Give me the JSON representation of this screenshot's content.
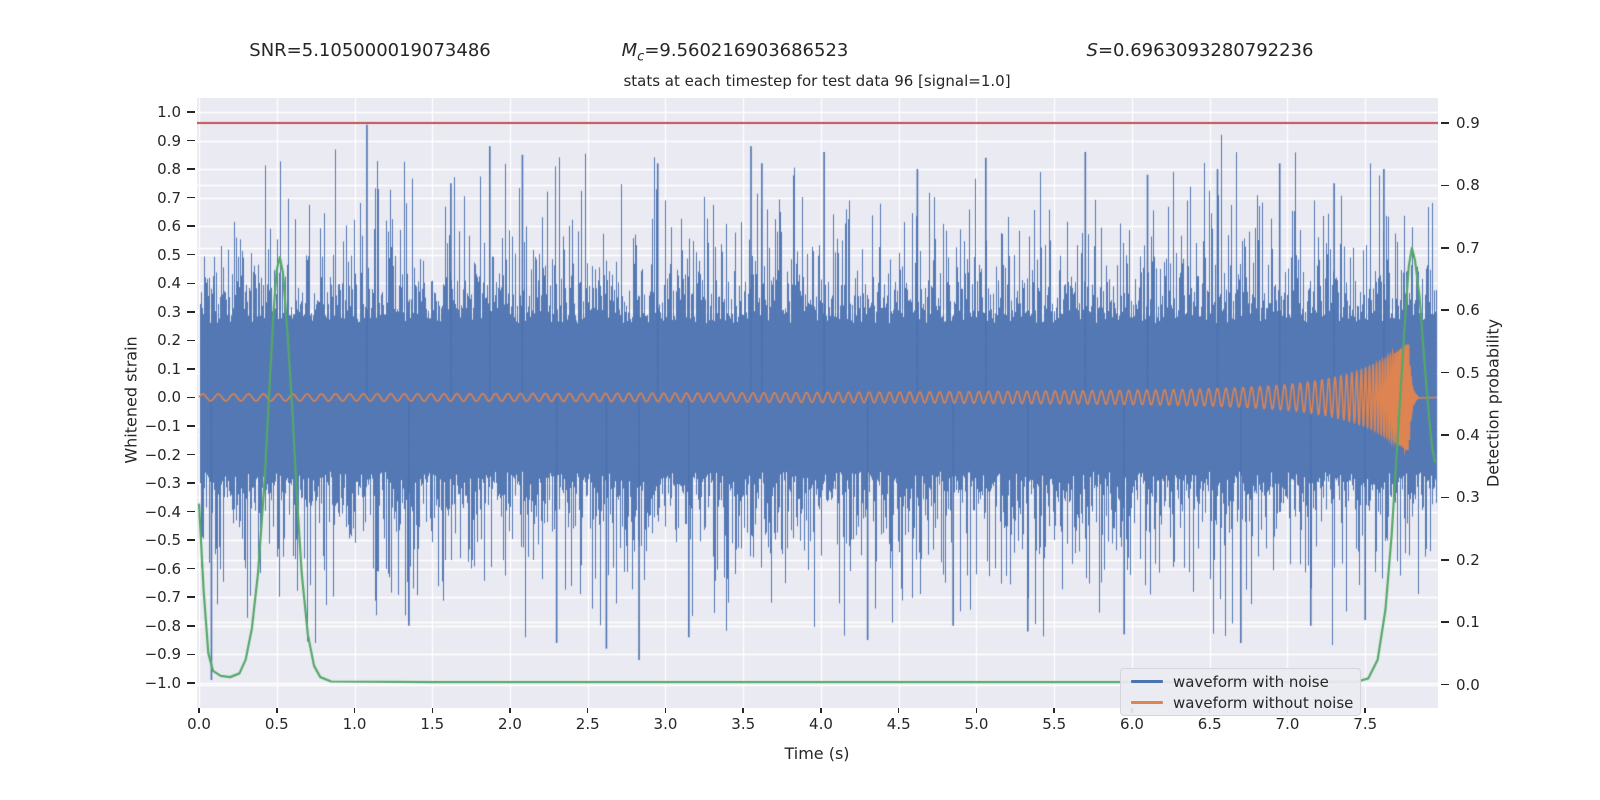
{
  "titles": {
    "snr": "SNR=5.105000019073486",
    "mc_var": "M",
    "mc_sub": "c",
    "mc_value": "=9.560216903686523",
    "s_var": "S",
    "s_value": "=0.6963093280792236",
    "subtitle": "stats at each timestep for test data 96 [signal=1.0]"
  },
  "legend": {
    "items": [
      {
        "label": "waveform with noise",
        "color": "#4C72B0"
      },
      {
        "label": "waveform without noise",
        "color": "#DD8452"
      }
    ]
  },
  "colors": {
    "noise_blue": "#4C72B0",
    "clean_orange": "#DD8452",
    "probability_green": "#55A868",
    "threshold_red": "#C44E52",
    "axes_bg": "#EAEAF2",
    "grid": "#ffffff",
    "text": "#262626"
  },
  "chart_data": {
    "type": "line",
    "title": "stats at each timestep for test data 96 [signal=1.0]",
    "xlabel": "Time (s)",
    "xlim": [
      -0.0129,
      7.968
    ],
    "xticks": [
      0.0,
      0.5,
      1.0,
      1.5,
      2.0,
      2.5,
      3.0,
      3.5,
      4.0,
      4.5,
      5.0,
      5.5,
      6.0,
      6.5,
      7.0,
      7.5
    ],
    "xtick_labels": [
      "0.0",
      "0.5",
      "1.0",
      "1.5",
      "2.0",
      "2.5",
      "3.0",
      "3.5",
      "4.0",
      "4.5",
      "5.0",
      "5.5",
      "6.0",
      "6.5",
      "7.0",
      "7.5"
    ],
    "grid": true,
    "legend_position": "lower right",
    "y_left": {
      "label": "Whitened strain",
      "lim": [
        -1.088,
        1.049
      ],
      "ticks": [
        1.0,
        0.9,
        0.8,
        0.7,
        0.6,
        0.5,
        0.4,
        0.3,
        0.2,
        0.1,
        0.0,
        -0.1,
        -0.2,
        -0.3,
        -0.4,
        -0.5,
        -0.6,
        -0.7,
        -0.8,
        -0.9,
        -1.0
      ],
      "tick_labels": [
        "1.0",
        "0.9",
        "0.8",
        "0.7",
        "0.6",
        "0.5",
        "0.4",
        "0.3",
        "0.2",
        "0.1",
        "0.0",
        "−0.1",
        "−0.2",
        "−0.3",
        "−0.4",
        "−0.5",
        "−0.6",
        "−0.7",
        "−0.8",
        "−0.9",
        "−1.0"
      ]
    },
    "y_right": {
      "label": "Detection probability",
      "lim": [
        -0.0375,
        0.9401
      ],
      "ticks": [
        0.9,
        0.8,
        0.7,
        0.6,
        0.5,
        0.4,
        0.3,
        0.2,
        0.1,
        0.0
      ],
      "tick_labels": [
        "0.9",
        "0.8",
        "0.7",
        "0.6",
        "0.5",
        "0.4",
        "0.3",
        "0.2",
        "0.1",
        "0.0"
      ]
    },
    "series": [
      {
        "name": "waveform with noise",
        "axis": "left",
        "type": "noise_band",
        "color": "#4C72B0",
        "seed": 1337,
        "core_halfwidth": 0.26,
        "core_jitter": 0.1,
        "spike_prob": 0.3,
        "spike_base": 0.05,
        "spike_jitter": 0.18,
        "max_abs": 0.92,
        "extremes": [
          [
            0.08,
            -0.99
          ],
          [
            1.08,
            0.955
          ],
          [
            1.35,
            -0.8
          ],
          [
            1.62,
            0.75
          ],
          [
            1.87,
            0.88
          ],
          [
            2.08,
            0.85
          ],
          [
            2.3,
            -0.86
          ],
          [
            2.62,
            -0.88
          ],
          [
            2.83,
            -0.92
          ],
          [
            2.95,
            0.82
          ],
          [
            3.15,
            -0.84
          ],
          [
            3.55,
            0.88
          ],
          [
            3.62,
            0.82
          ],
          [
            4.02,
            0.86
          ],
          [
            4.3,
            -0.85
          ],
          [
            4.62,
            0.8
          ],
          [
            4.85,
            -0.8
          ],
          [
            5.06,
            0.84
          ],
          [
            5.33,
            -0.82
          ],
          [
            5.7,
            0.86
          ],
          [
            5.95,
            -0.83
          ],
          [
            6.1,
            0.78
          ],
          [
            6.55,
            0.8
          ],
          [
            6.7,
            -0.86
          ],
          [
            6.95,
            0.82
          ],
          [
            7.15,
            -0.8
          ],
          [
            7.3,
            0.75
          ],
          [
            7.5,
            -0.78
          ],
          [
            7.62,
            0.8
          ]
        ]
      },
      {
        "name": "waveform without noise",
        "axis": "left",
        "type": "chirp",
        "color": "#DD8452",
        "amp_start": 0.012,
        "amp_quad": 0.02,
        "amp_merger_gain": 0.16,
        "amp_merger_tau": 0.35,
        "amp_cap": 0.185,
        "t_merger": 7.78,
        "ringdown_tau": 0.015,
        "f0_hz": 10,
        "f_lin": 1.2,
        "f_merger_gain": 90,
        "f_merger_tau": 0.18,
        "flat_end_t": 7.96,
        "flat_level": 0.0
      },
      {
        "name": "detection probability",
        "axis": "right",
        "type": "line",
        "color": "#55A868",
        "points": [
          [
            0.0,
            0.29
          ],
          [
            0.03,
            0.15
          ],
          [
            0.06,
            0.05
          ],
          [
            0.09,
            0.022
          ],
          [
            0.14,
            0.014
          ],
          [
            0.2,
            0.012
          ],
          [
            0.26,
            0.018
          ],
          [
            0.3,
            0.04
          ],
          [
            0.34,
            0.09
          ],
          [
            0.38,
            0.18
          ],
          [
            0.42,
            0.32
          ],
          [
            0.45,
            0.46
          ],
          [
            0.48,
            0.6
          ],
          [
            0.5,
            0.665
          ],
          [
            0.52,
            0.685
          ],
          [
            0.54,
            0.66
          ],
          [
            0.57,
            0.56
          ],
          [
            0.6,
            0.44
          ],
          [
            0.63,
            0.3
          ],
          [
            0.66,
            0.18
          ],
          [
            0.7,
            0.08
          ],
          [
            0.74,
            0.03
          ],
          [
            0.78,
            0.012
          ],
          [
            0.85,
            0.005
          ],
          [
            1.5,
            0.004
          ],
          [
            3.0,
            0.004
          ],
          [
            5.0,
            0.004
          ],
          [
            7.0,
            0.004
          ],
          [
            7.45,
            0.005
          ],
          [
            7.52,
            0.01
          ],
          [
            7.58,
            0.04
          ],
          [
            7.63,
            0.12
          ],
          [
            7.67,
            0.24
          ],
          [
            7.7,
            0.36
          ],
          [
            7.73,
            0.48
          ],
          [
            7.76,
            0.6
          ],
          [
            7.78,
            0.67
          ],
          [
            7.8,
            0.7
          ],
          [
            7.82,
            0.68
          ],
          [
            7.85,
            0.62
          ],
          [
            7.88,
            0.52
          ],
          [
            7.91,
            0.43
          ],
          [
            7.93,
            0.38
          ],
          [
            7.95,
            0.355
          ]
        ]
      },
      {
        "name": "detection threshold",
        "axis": "right",
        "type": "hline",
        "color": "#C44E52",
        "value": 0.9
      }
    ]
  }
}
